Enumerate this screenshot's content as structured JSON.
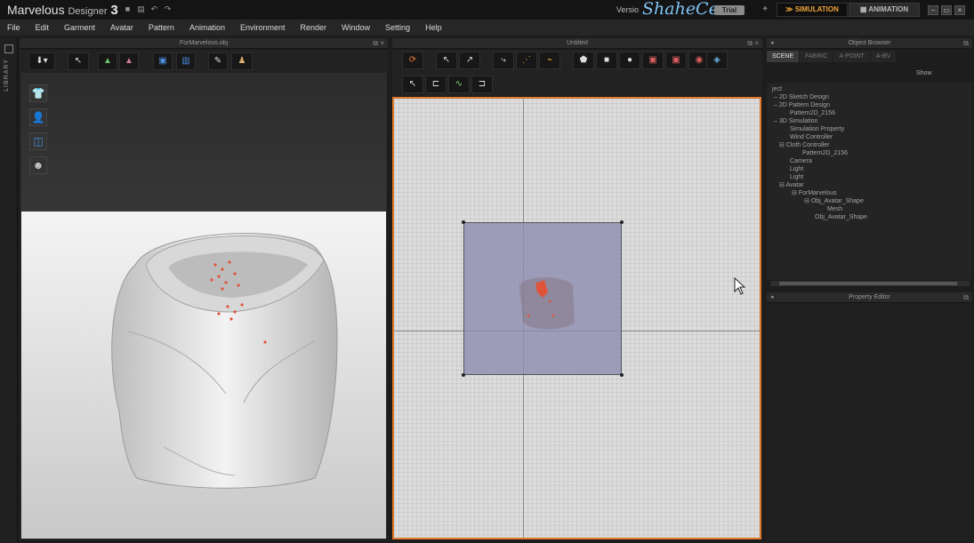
{
  "titlebar": {
    "app_name": "Marvelous",
    "app_sub": "Designer",
    "app_version": "3",
    "version_label": "Versio",
    "watermark": "ShaheCe",
    "trial": "Trial",
    "mode_simulation": "SIMULATION",
    "mode_animation": "ANIMATION",
    "win_min": "–",
    "win_max": "▭",
    "win_close": "×"
  },
  "menu": [
    "File",
    "Edit",
    "Garment",
    "Avatar",
    "Pattern",
    "Animation",
    "Environment",
    "Render",
    "Window",
    "Setting",
    "Help"
  ],
  "library_label": "LIBRARY",
  "panels": {
    "left_title": "ForMarvelous.obj",
    "center_title": "Untitled",
    "object_browser_title": "Object Browser",
    "property_editor_title": "Property Editor"
  },
  "object_browser": {
    "tabs": [
      "SCENE",
      "FABRIC",
      "A-POINT",
      "A-BV"
    ],
    "show_label": "Show",
    "tree": [
      "ject",
      "2D Sketch Design",
      "2D Pattern Design",
      "Pattern2D_2156",
      "3D Simulation",
      "Simulation Property",
      "Wind Controller",
      "Cloth Controller",
      "Pattern2D_2156",
      "Camera",
      "Light",
      "Light",
      "Avatar",
      "ForMarvelous",
      "Obj_Avatar_Shape",
      "Mesh",
      "Obj_Avatar_Shape"
    ]
  },
  "colors": {
    "accent": "#e07a2a",
    "simulation": "#f0a43a",
    "pattern_fill": "#8c8caf",
    "pin_red": "#e0553a"
  }
}
